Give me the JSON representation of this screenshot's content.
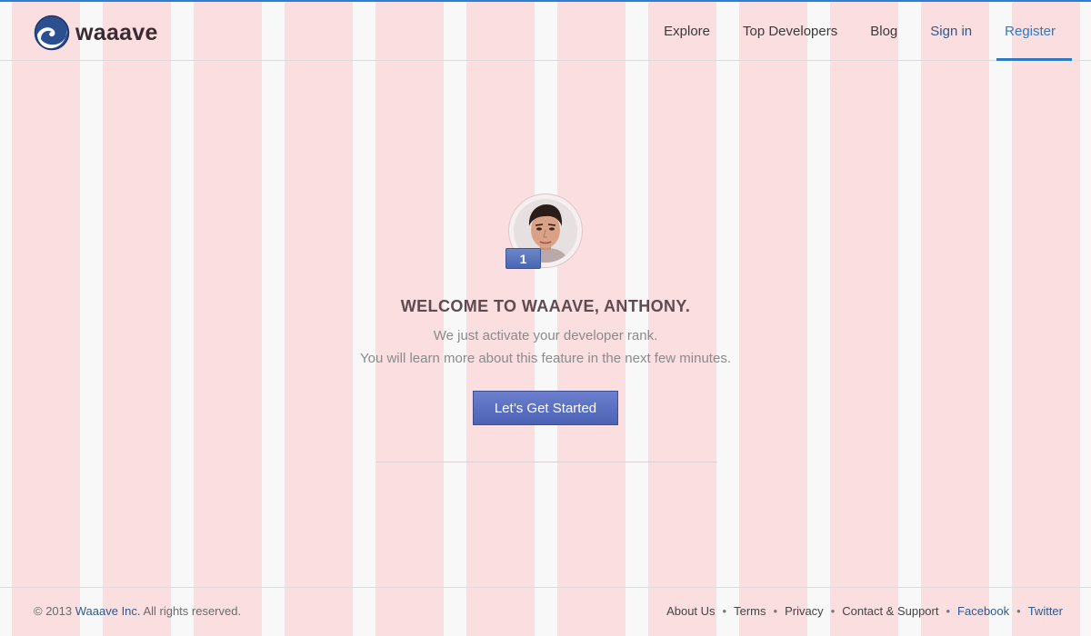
{
  "header": {
    "logo_text": "waaave",
    "nav": [
      {
        "label": "Explore"
      },
      {
        "label": "Top Developers"
      },
      {
        "label": "Blog"
      },
      {
        "label": "Sign in"
      },
      {
        "label": "Register"
      }
    ]
  },
  "main": {
    "rank_badge": "1",
    "title": "WELCOME TO WAAAVE, ANTHONY.",
    "line1": "We just activate your developer rank.",
    "line2": "You will learn more about this feature in the next few minutes.",
    "cta_label": "Let’s Get Started"
  },
  "footer": {
    "copyright_prefix": "© 2013",
    "copyright_brand": "Waaave Inc.",
    "copyright_suffix": "All rights reserved.",
    "links": [
      "About Us",
      "Terms",
      "Privacy",
      "Contact & Support",
      "Facebook",
      "Twitter"
    ],
    "separator": "•"
  },
  "colors": {
    "accent": "#2e7ac0",
    "button": "#5b70c2",
    "grid_overlay": "#ffb4b9"
  }
}
